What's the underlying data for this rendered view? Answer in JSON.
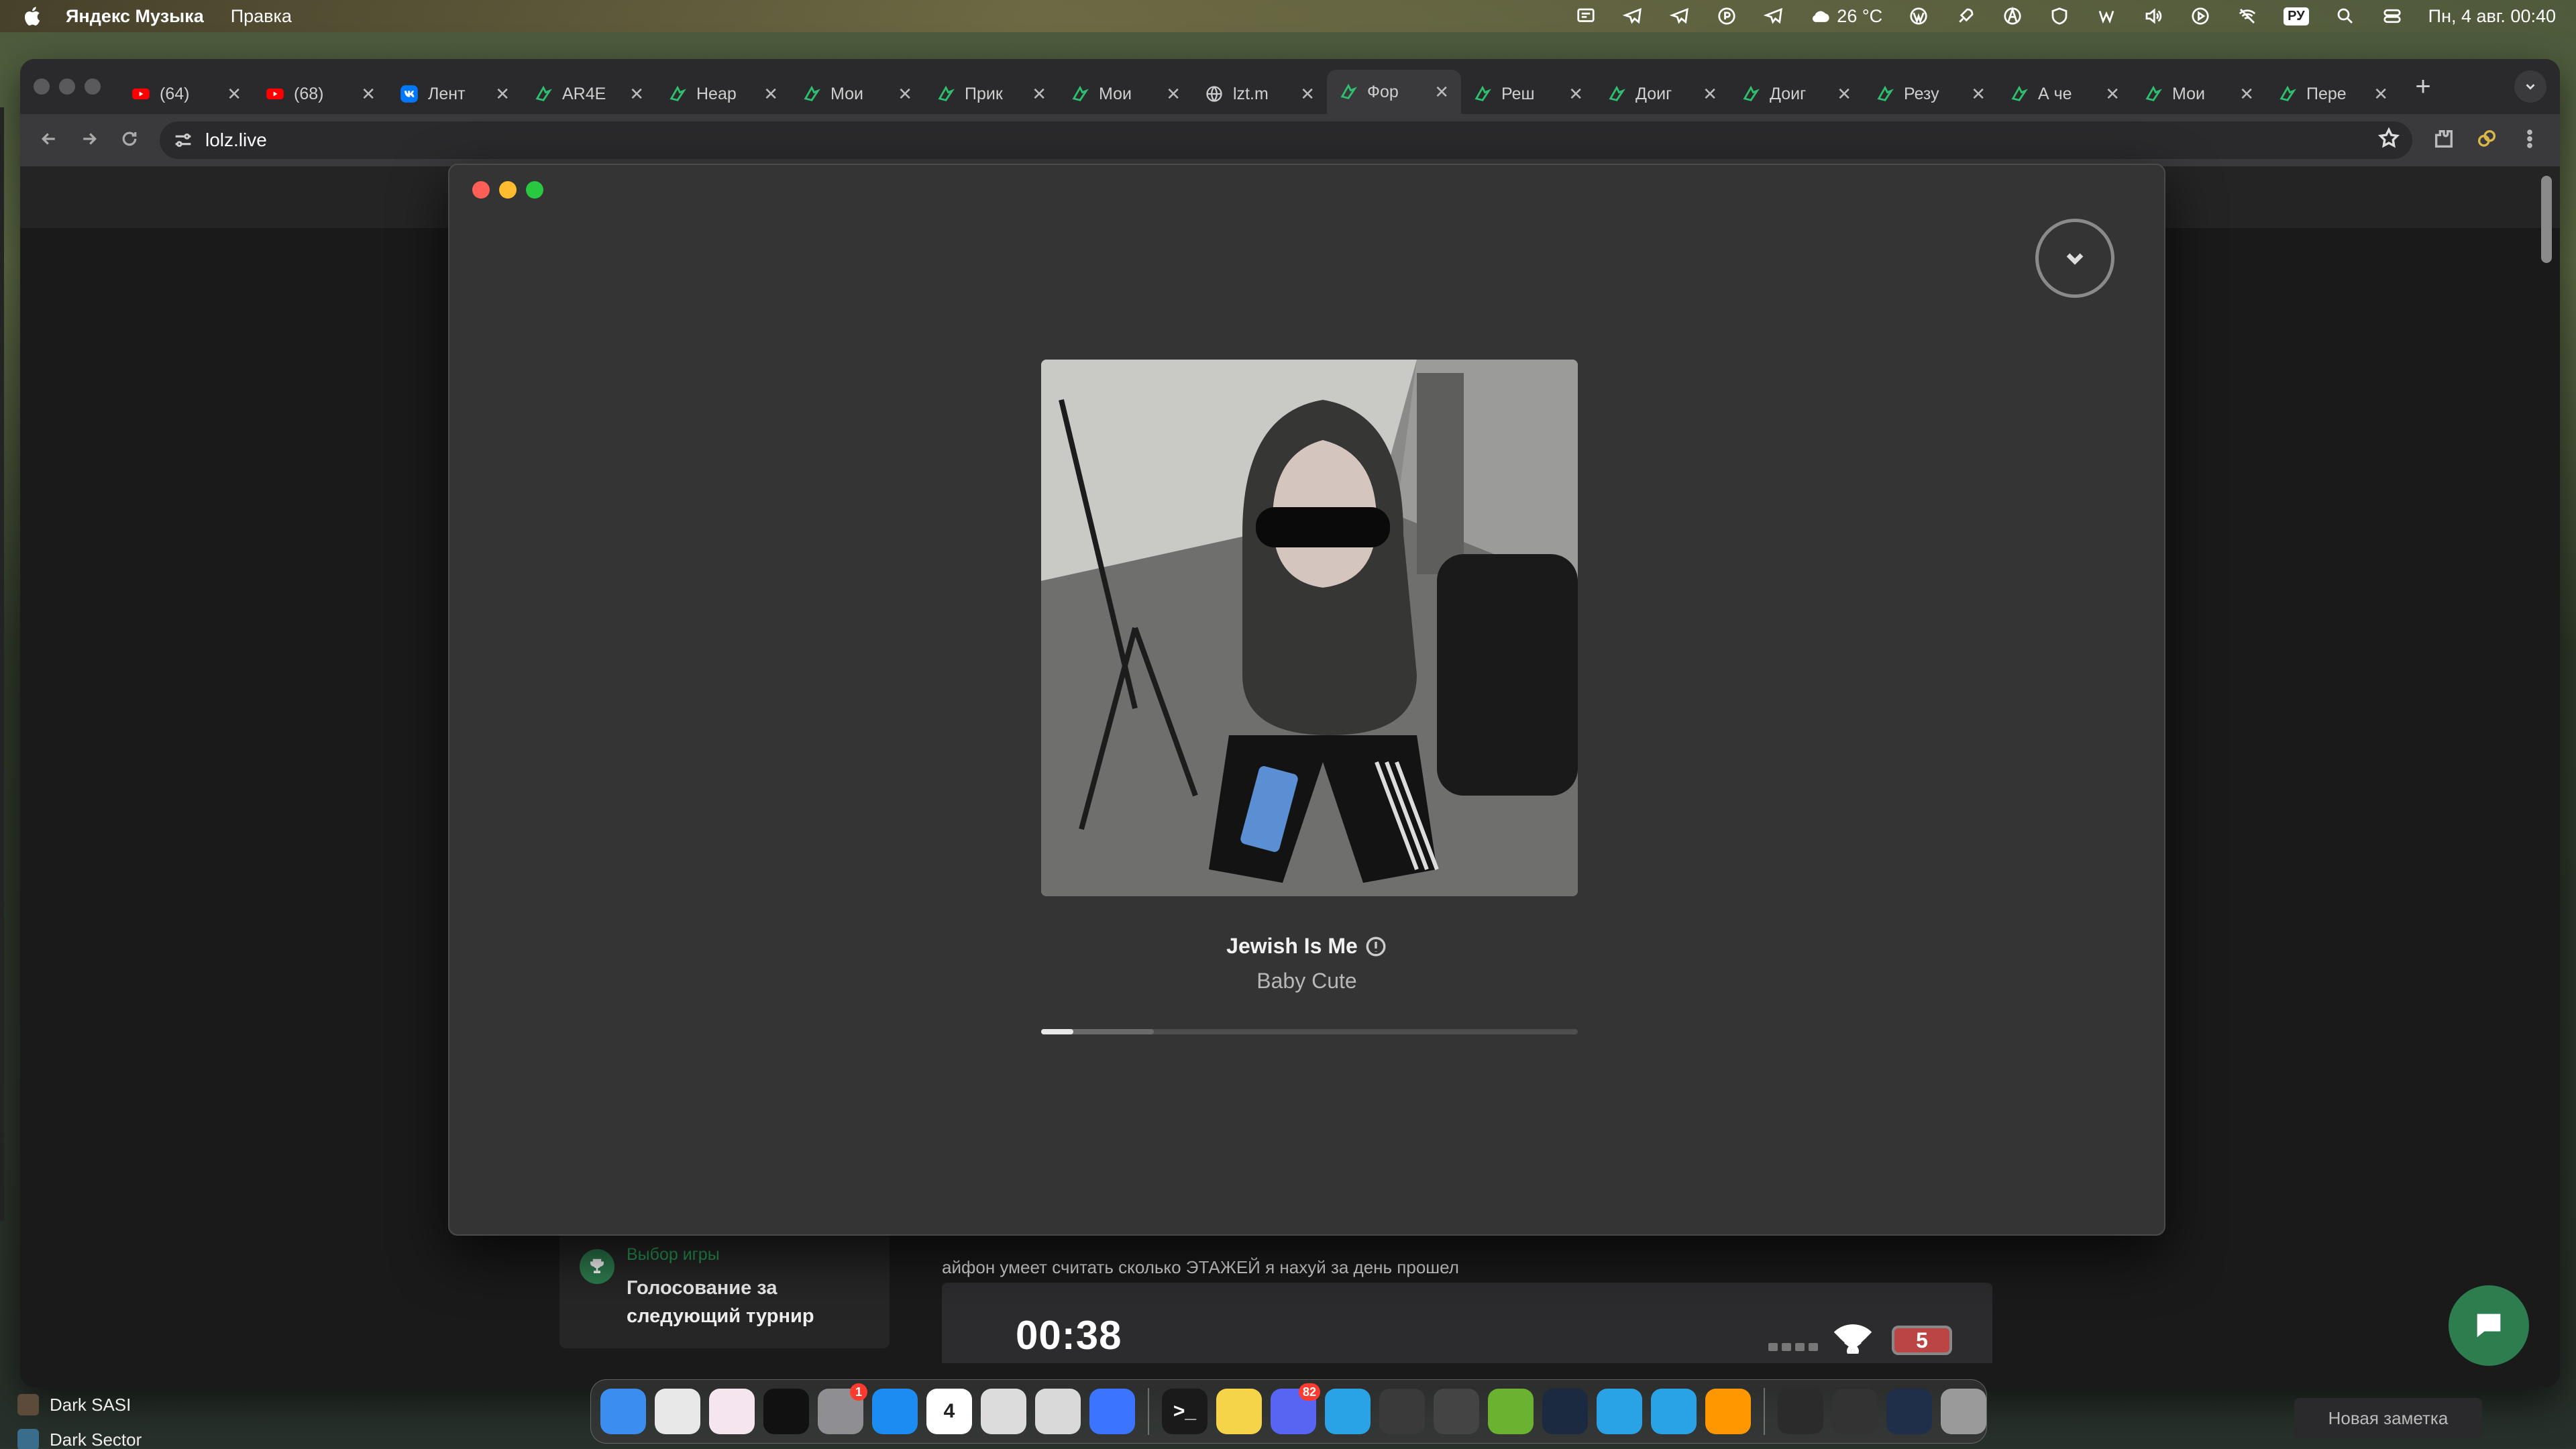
{
  "menubar": {
    "app_name": "Яндекс Музыка",
    "menu": [
      "Правка"
    ],
    "weather": "26 °C",
    "input_lang": "РУ",
    "datetime": "Пн, 4 авг.  00:40"
  },
  "browser": {
    "tabs": [
      {
        "label": "(64)",
        "icon": "youtube-icon"
      },
      {
        "label": "(68)",
        "icon": "youtube-icon"
      },
      {
        "label": "Лент",
        "icon": "vk-icon"
      },
      {
        "label": "AR4E",
        "icon": "lolz-icon"
      },
      {
        "label": "Неар",
        "icon": "lolz-icon"
      },
      {
        "label": "Мои",
        "icon": "lolz-icon"
      },
      {
        "label": "Прик",
        "icon": "lolz-icon"
      },
      {
        "label": "Мои",
        "icon": "lolz-icon"
      },
      {
        "label": "lzt.m",
        "icon": "globe-icon"
      },
      {
        "label": "Фор",
        "icon": "lolz-icon",
        "active": true
      },
      {
        "label": "Реш",
        "icon": "lolz-icon"
      },
      {
        "label": "Доиг",
        "icon": "lolz-icon"
      },
      {
        "label": "Доиг",
        "icon": "lolz-icon"
      },
      {
        "label": "Резу",
        "icon": "lolz-icon"
      },
      {
        "label": "А че",
        "icon": "lolz-icon"
      },
      {
        "label": "Мои",
        "icon": "lolz-icon"
      },
      {
        "label": "Пере",
        "icon": "lolz-icon"
      }
    ],
    "new_tab": "+",
    "url": "lolz.live"
  },
  "player": {
    "track_title": "Jewish Is Me",
    "artist": "Baby Cute",
    "progress_played": 0.06,
    "progress_buffered": 0.21
  },
  "page": {
    "vote": {
      "label": "Выбор игры",
      "description": "Голосование за следующий турнир"
    },
    "post_text": "айфон умеет считать сколько ЭТАЖЕЙ я нахуй за день прошел",
    "post_image": {
      "time": "00:38",
      "battery": "5"
    }
  },
  "dock": {
    "items": [
      {
        "name": "finder",
        "color": "#3b8ef0"
      },
      {
        "name": "chrome",
        "color": "#e8e8e8"
      },
      {
        "name": "arc",
        "color": "#f4e5ef"
      },
      {
        "name": "spark",
        "color": "#111111"
      },
      {
        "name": "system-settings",
        "color": "#8e8e93",
        "badge": "1"
      },
      {
        "name": "app-store",
        "color": "#1c8bf2"
      },
      {
        "name": "calendar",
        "color": "#ffffff",
        "text": "4"
      },
      {
        "name": "preview",
        "color": "#dcdcdc"
      },
      {
        "name": "launchpad",
        "color": "#d9d9d9"
      },
      {
        "name": "roblox",
        "color": "#3a74ff"
      },
      {
        "name": "terminal",
        "color": "#1a1a1a",
        "text": ">_"
      },
      {
        "name": "notes",
        "color": "#f6d44a"
      },
      {
        "name": "discord",
        "color": "#5865f2",
        "badge": "82"
      },
      {
        "name": "telegram",
        "color": "#2aa3e6"
      },
      {
        "name": "rocket",
        "color": "#3a3a3a"
      },
      {
        "name": "anarchy",
        "color": "#444444"
      },
      {
        "name": "utorrent",
        "color": "#6ab22f"
      },
      {
        "name": "steam",
        "color": "#1b2a40"
      },
      {
        "name": "telegram-2",
        "color": "#2aa3e6"
      },
      {
        "name": "telegram-3",
        "color": "#2aa3e6"
      },
      {
        "name": "sublime",
        "color": "#ff9800"
      },
      {
        "name": "thumb-1",
        "color": "#2b2b2b"
      },
      {
        "name": "thumb-2",
        "color": "#333333"
      },
      {
        "name": "thumb-3",
        "color": "#1f2f4a"
      },
      {
        "name": "trash",
        "color": "#9a9a9a"
      }
    ]
  },
  "taskbar": {
    "items": [
      "Dark SASI",
      "Dark Sector"
    ],
    "note_button": "Новая заметка"
  },
  "colors": {
    "accent_green": "#2e7d4f",
    "window_bg": "#343434"
  }
}
